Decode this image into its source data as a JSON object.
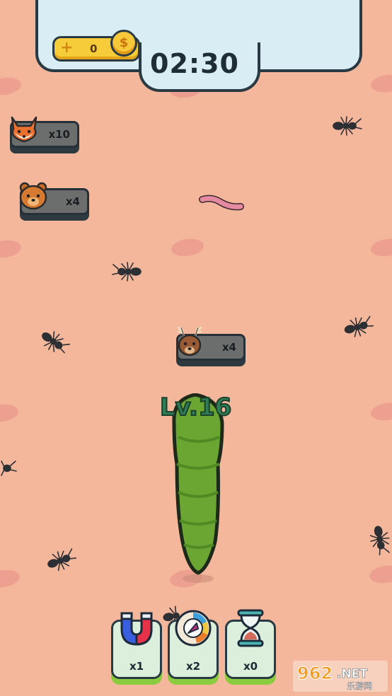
{
  "hud": {
    "coins": "0",
    "coin_plus": "+",
    "coin_symbol": "$",
    "timer": "02:30"
  },
  "targets": [
    {
      "animal": "fox-icon",
      "count": "x10"
    },
    {
      "animal": "bear-icon",
      "count": "x4"
    },
    {
      "animal": "deer-icon",
      "count": "x4"
    }
  ],
  "player": {
    "level_label": "Lv.16"
  },
  "powerups": [
    {
      "name": "magnet-icon",
      "count": "x1"
    },
    {
      "name": "compass-icon",
      "count": "x2"
    },
    {
      "name": "hourglass-icon",
      "count": "x0"
    }
  ],
  "watermark": {
    "brand": "962.NET",
    "sub": "乐游网"
  },
  "colors": {
    "ground": "#f4b79c",
    "hud_panel": "#d9eef4",
    "snake_green": "#6aa631",
    "level_text": "#2f7d56",
    "coin_gold": "#f6cc3a"
  }
}
